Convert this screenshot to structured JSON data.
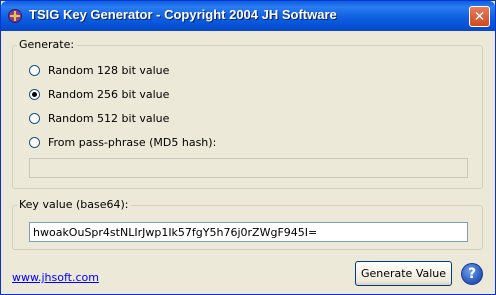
{
  "window": {
    "title": "TSIG Key Generator - Copyright 2004 JH Software",
    "close_glyph": "✕"
  },
  "generate_group": {
    "legend": "Generate:",
    "options": [
      {
        "label": "Random 128 bit value",
        "checked": false
      },
      {
        "label": "Random 256 bit value",
        "checked": true
      },
      {
        "label": "Random 512 bit value",
        "checked": false
      },
      {
        "label": "From pass-phrase (MD5 hash):",
        "checked": false
      }
    ],
    "passphrase_value": ""
  },
  "key_group": {
    "legend": "Key value (base64):",
    "key_value": "hwoakOuSpr4stNLIrJwp1Ik57fgY5h76j0rZWgF945I="
  },
  "footer": {
    "website_link": "www.jhsoft.com",
    "generate_button": "Generate Value",
    "help_glyph": "?"
  }
}
